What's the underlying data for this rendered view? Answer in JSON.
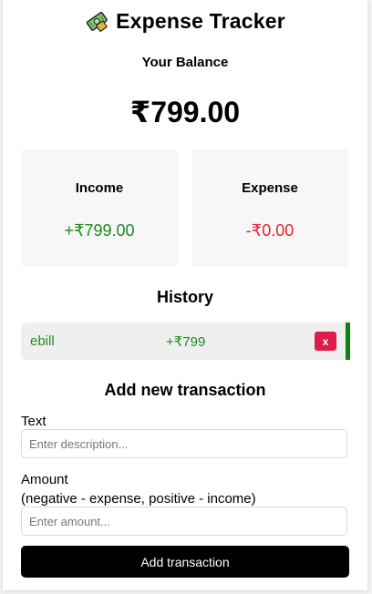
{
  "header": {
    "title": "Expense Tracker",
    "logo_icon": "money-bag-icon"
  },
  "balance": {
    "label": "Your Balance",
    "value": "₹799.00"
  },
  "summary": {
    "income": {
      "label": "Income",
      "value": "+₹799.00",
      "color": "#1e8a1e"
    },
    "expense": {
      "label": "Expense",
      "value": "-₹0.00",
      "color": "#e0242e"
    }
  },
  "history": {
    "title": "History",
    "items": [
      {
        "text": "ebill",
        "amount": "+₹799",
        "delete_label": "x",
        "type": "income",
        "border_color": "#108010"
      }
    ]
  },
  "form": {
    "title": "Add new transaction",
    "text_label": "Text",
    "text_placeholder": "Enter description...",
    "amount_label_line1": "Amount",
    "amount_label_line2": "(negative - expense, positive - income)",
    "amount_placeholder": "Enter amount...",
    "submit_label": "Add transaction"
  }
}
